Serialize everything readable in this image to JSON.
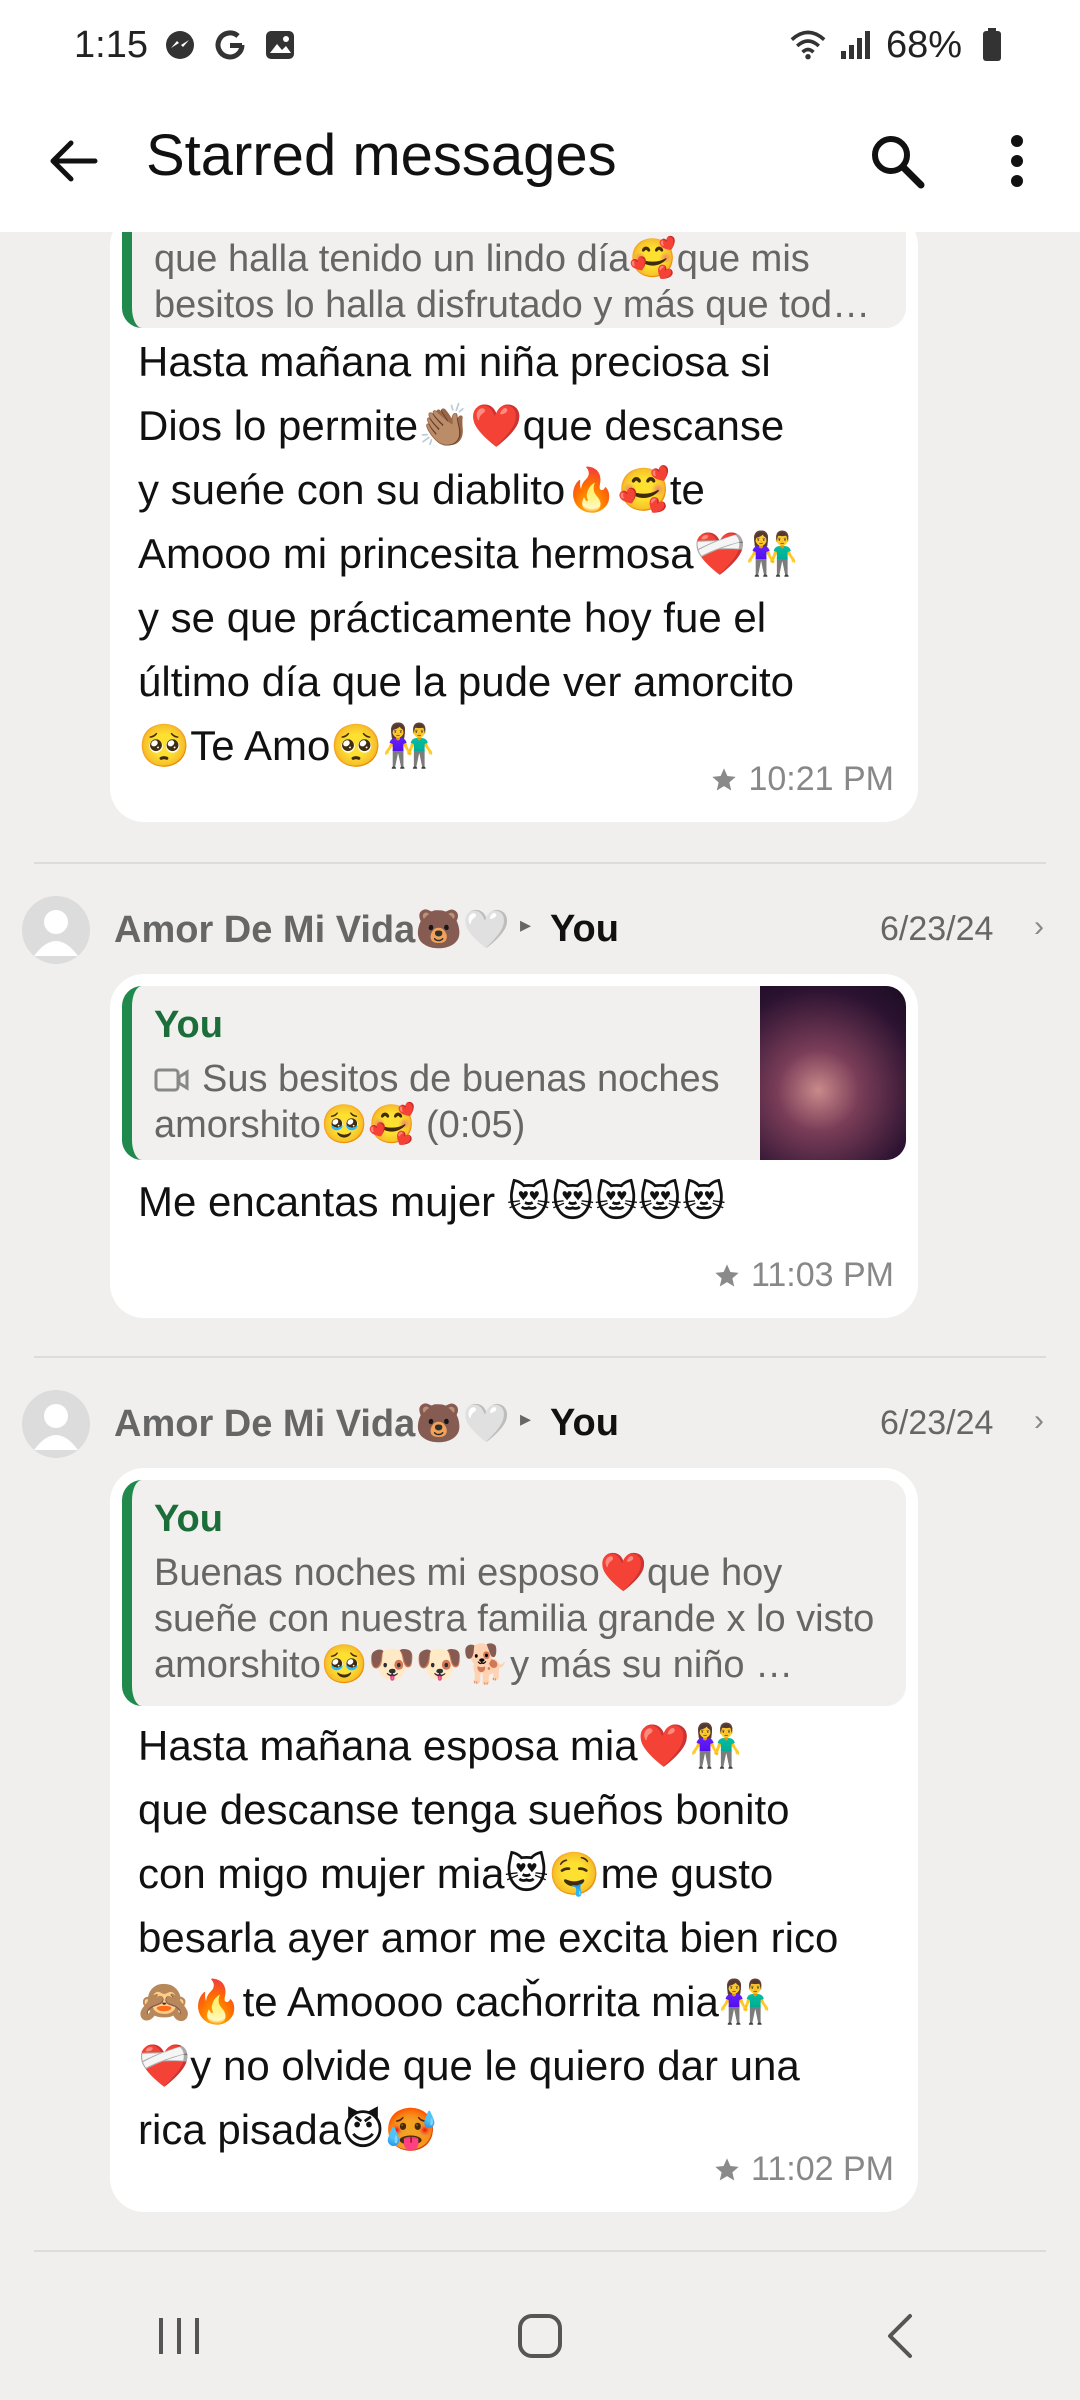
{
  "status": {
    "time": "1:15",
    "battery": "68%"
  },
  "header": {
    "title": "Starred messages"
  },
  "messages": [
    {
      "quote_text": "que halla tenido un lindo día🥰que mis besitos lo halla disfrutado y más que tod…",
      "body": "Hasta mañana mi niña preciosa si\nDios lo permite👏🏽❤️que descanse\ny sueńe con su diablito🔥🥰te\nAmooo mi princesita hermosa❤️‍🩹👫\ny se que prácticamente hoy fue el\núltimo día que la pude ver amorcito\n🥺Te Amo🥺👫",
      "time": "10:21 PM"
    },
    {
      "sender": "Amor De Mi Vida🐻🤍",
      "recipient": "You",
      "date": "6/23/24",
      "quote_author": "You",
      "quote_text": "Sus besitos de buenas noches amorshito🥹🥰 (0:05)",
      "body": "Me encantas mujer 😻😻😻😻😻",
      "time": "11:03 PM"
    },
    {
      "sender": "Amor De Mi Vida🐻🤍",
      "recipient": "You",
      "date": "6/23/24",
      "quote_author": "You",
      "quote_text": "Buenas noches mi esposo❤️que hoy sueñe con nuestra familia grande x lo visto amorshito🥹🐶🐶🐕y más su niño …",
      "body": "Hasta mañana esposa mia❤️👫\nque descanse tenga sueños bonito\ncon migo mujer mia😻🤤me gusto\nbesarla ayer amor me excita bien rico\n🙈🔥te Amoooo cacȟorrita mia👫\n❤️‍🩹y no olvide que le quiero dar una\nrica pisada😈🥵",
      "time": "11:02 PM"
    }
  ]
}
